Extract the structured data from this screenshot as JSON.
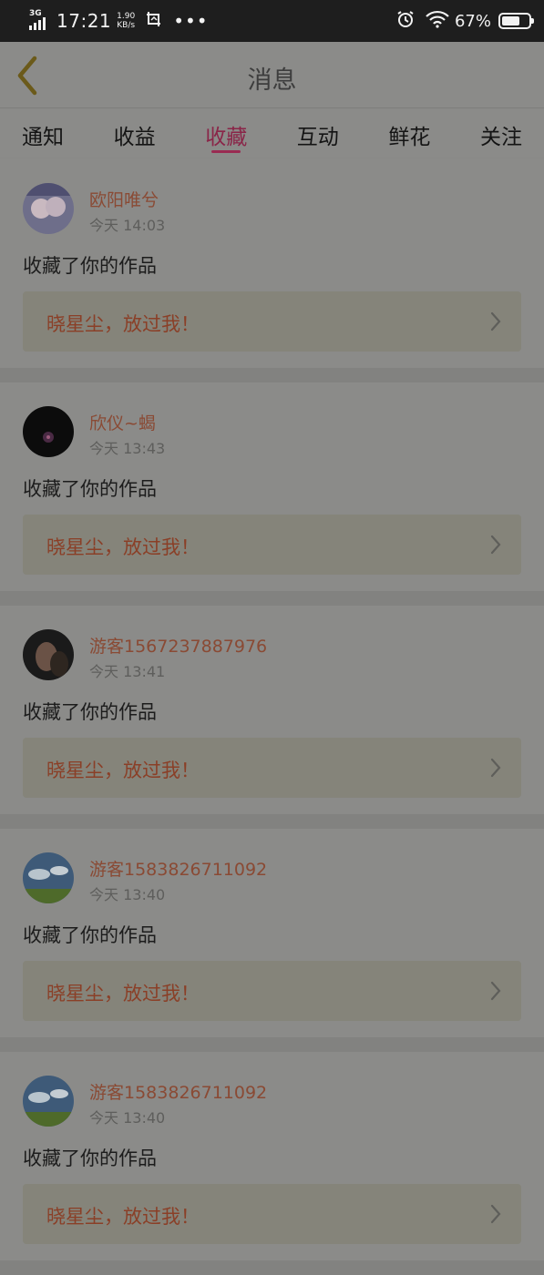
{
  "status_bar": {
    "network": "3G",
    "time": "17:21",
    "speed_value": "1.90",
    "speed_unit": "KB/s",
    "battery_percent_label": "67%",
    "battery_level": 0.67
  },
  "nav": {
    "title": "消息"
  },
  "tabs": [
    {
      "label": "通知"
    },
    {
      "label": "收益"
    },
    {
      "label": "收藏"
    },
    {
      "label": "互动"
    },
    {
      "label": "鲜花"
    },
    {
      "label": "关注"
    }
  ],
  "active_tab": 2,
  "messages": [
    {
      "user": "欧阳唯兮",
      "time": "今天 14:03",
      "action": "收藏了你的作品",
      "work": "晓星尘，放过我！",
      "avatar": "couple-photo-avatar"
    },
    {
      "user": "欣仪~蝎",
      "time": "今天 13:43",
      "action": "收藏了你的作品",
      "work": "晓星尘，放过我！",
      "avatar": "night-scene-avatar"
    },
    {
      "user": "游客1567237887976",
      "time": "今天 13:41",
      "action": "收藏了你的作品",
      "work": "晓星尘，放过我！",
      "avatar": "portrait-avatar"
    },
    {
      "user": "游客1583826711092",
      "time": "今天 13:40",
      "action": "收藏了你的作品",
      "work": "晓星尘，放过我！",
      "avatar": "sky-field-avatar"
    },
    {
      "user": "游客1583826711092",
      "time": "今天 13:40",
      "action": "收藏了你的作品",
      "work": "晓星尘，放过我！",
      "avatar": "sky-field-avatar"
    }
  ],
  "colors": {
    "accent": "#9a2b52",
    "username": "#8a4a34",
    "work_title": "#8a3f27"
  }
}
